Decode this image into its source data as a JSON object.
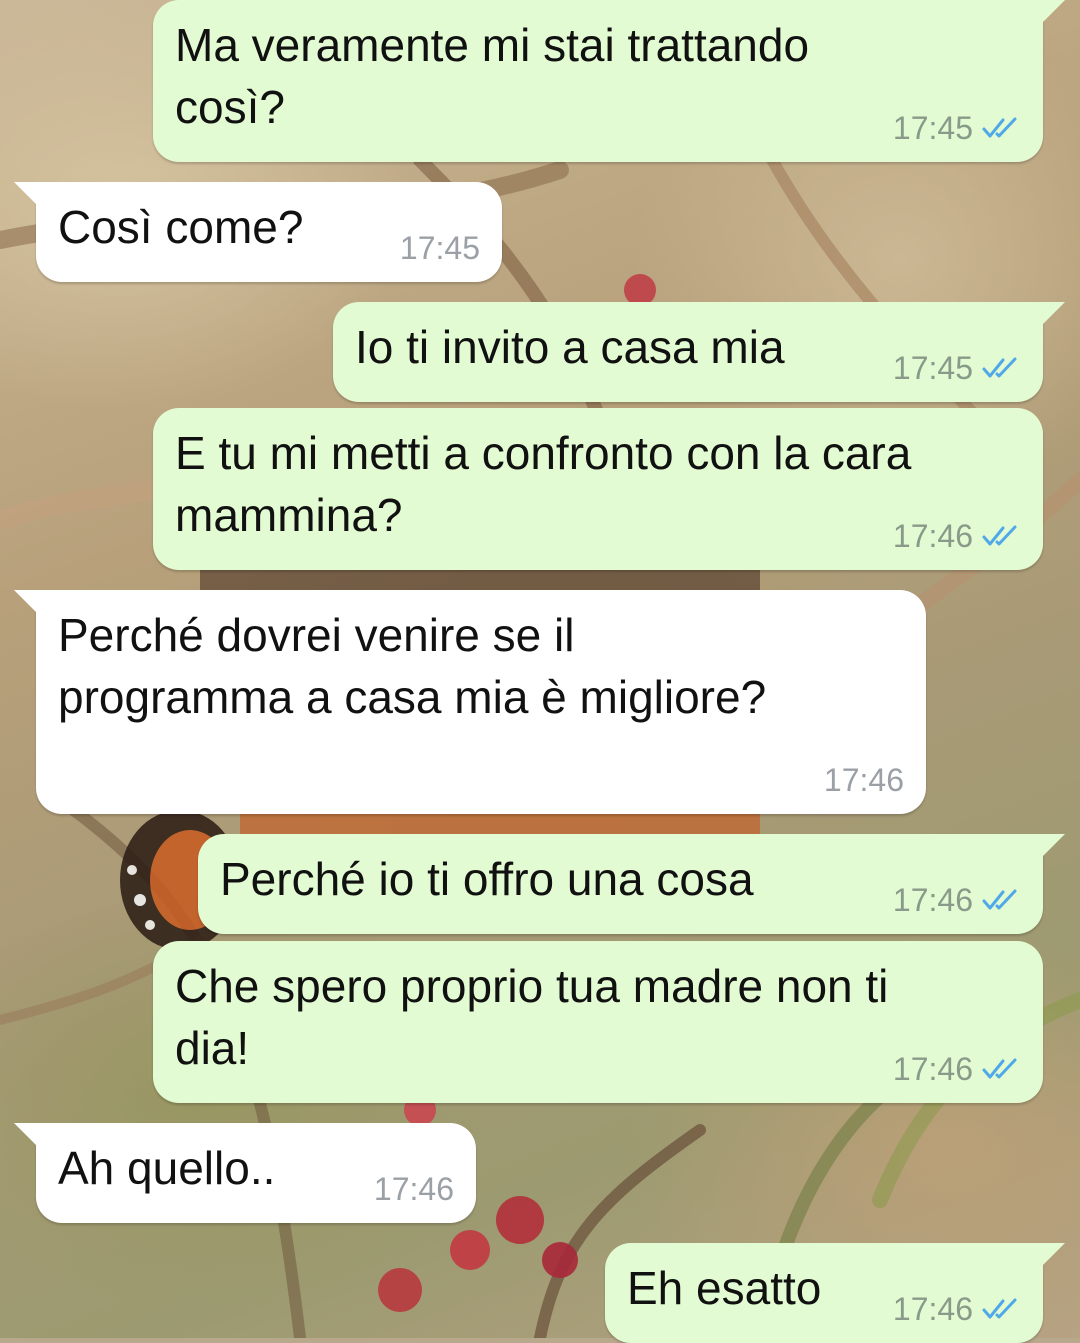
{
  "colors": {
    "outgoing_bubble": "#e2fbd2",
    "incoming_bubble": "#ffffff",
    "read_ticks": "#4fa9e8",
    "timestamp": "#8a9a8a"
  },
  "messages": [
    {
      "direction": "outgoing",
      "lines": [
        "Ma veramente mi stai trattando",
        "così?"
      ],
      "time": "17:45",
      "status": "read",
      "status_icon": "double-check-icon"
    },
    {
      "direction": "incoming",
      "lines": [
        "Così come?"
      ],
      "time": "17:45"
    },
    {
      "direction": "outgoing",
      "lines": [
        "Io ti invito a casa mia"
      ],
      "time": "17:45",
      "status": "read",
      "status_icon": "double-check-icon"
    },
    {
      "direction": "outgoing",
      "lines": [
        "E tu mi metti a confronto con la cara",
        "mammina?"
      ],
      "time": "17:46",
      "status": "read",
      "status_icon": "double-check-icon"
    },
    {
      "direction": "incoming",
      "lines": [
        "Perché dovrei venire se il",
        "programma a casa mia è migliore?"
      ],
      "time": "17:46"
    },
    {
      "direction": "outgoing",
      "lines": [
        "Perché io ti offro una cosa"
      ],
      "time": "17:46",
      "status": "read",
      "status_icon": "double-check-icon"
    },
    {
      "direction": "outgoing",
      "lines": [
        "Che spero proprio tua madre non ti",
        "dia!"
      ],
      "time": "17:46",
      "status": "read",
      "status_icon": "double-check-icon"
    },
    {
      "direction": "incoming",
      "lines": [
        "Ah quello.."
      ],
      "time": "17:46"
    },
    {
      "direction": "outgoing",
      "lines": [
        "Eh esatto"
      ],
      "time": "17:46",
      "status": "read",
      "status_icon": "double-check-icon"
    }
  ]
}
